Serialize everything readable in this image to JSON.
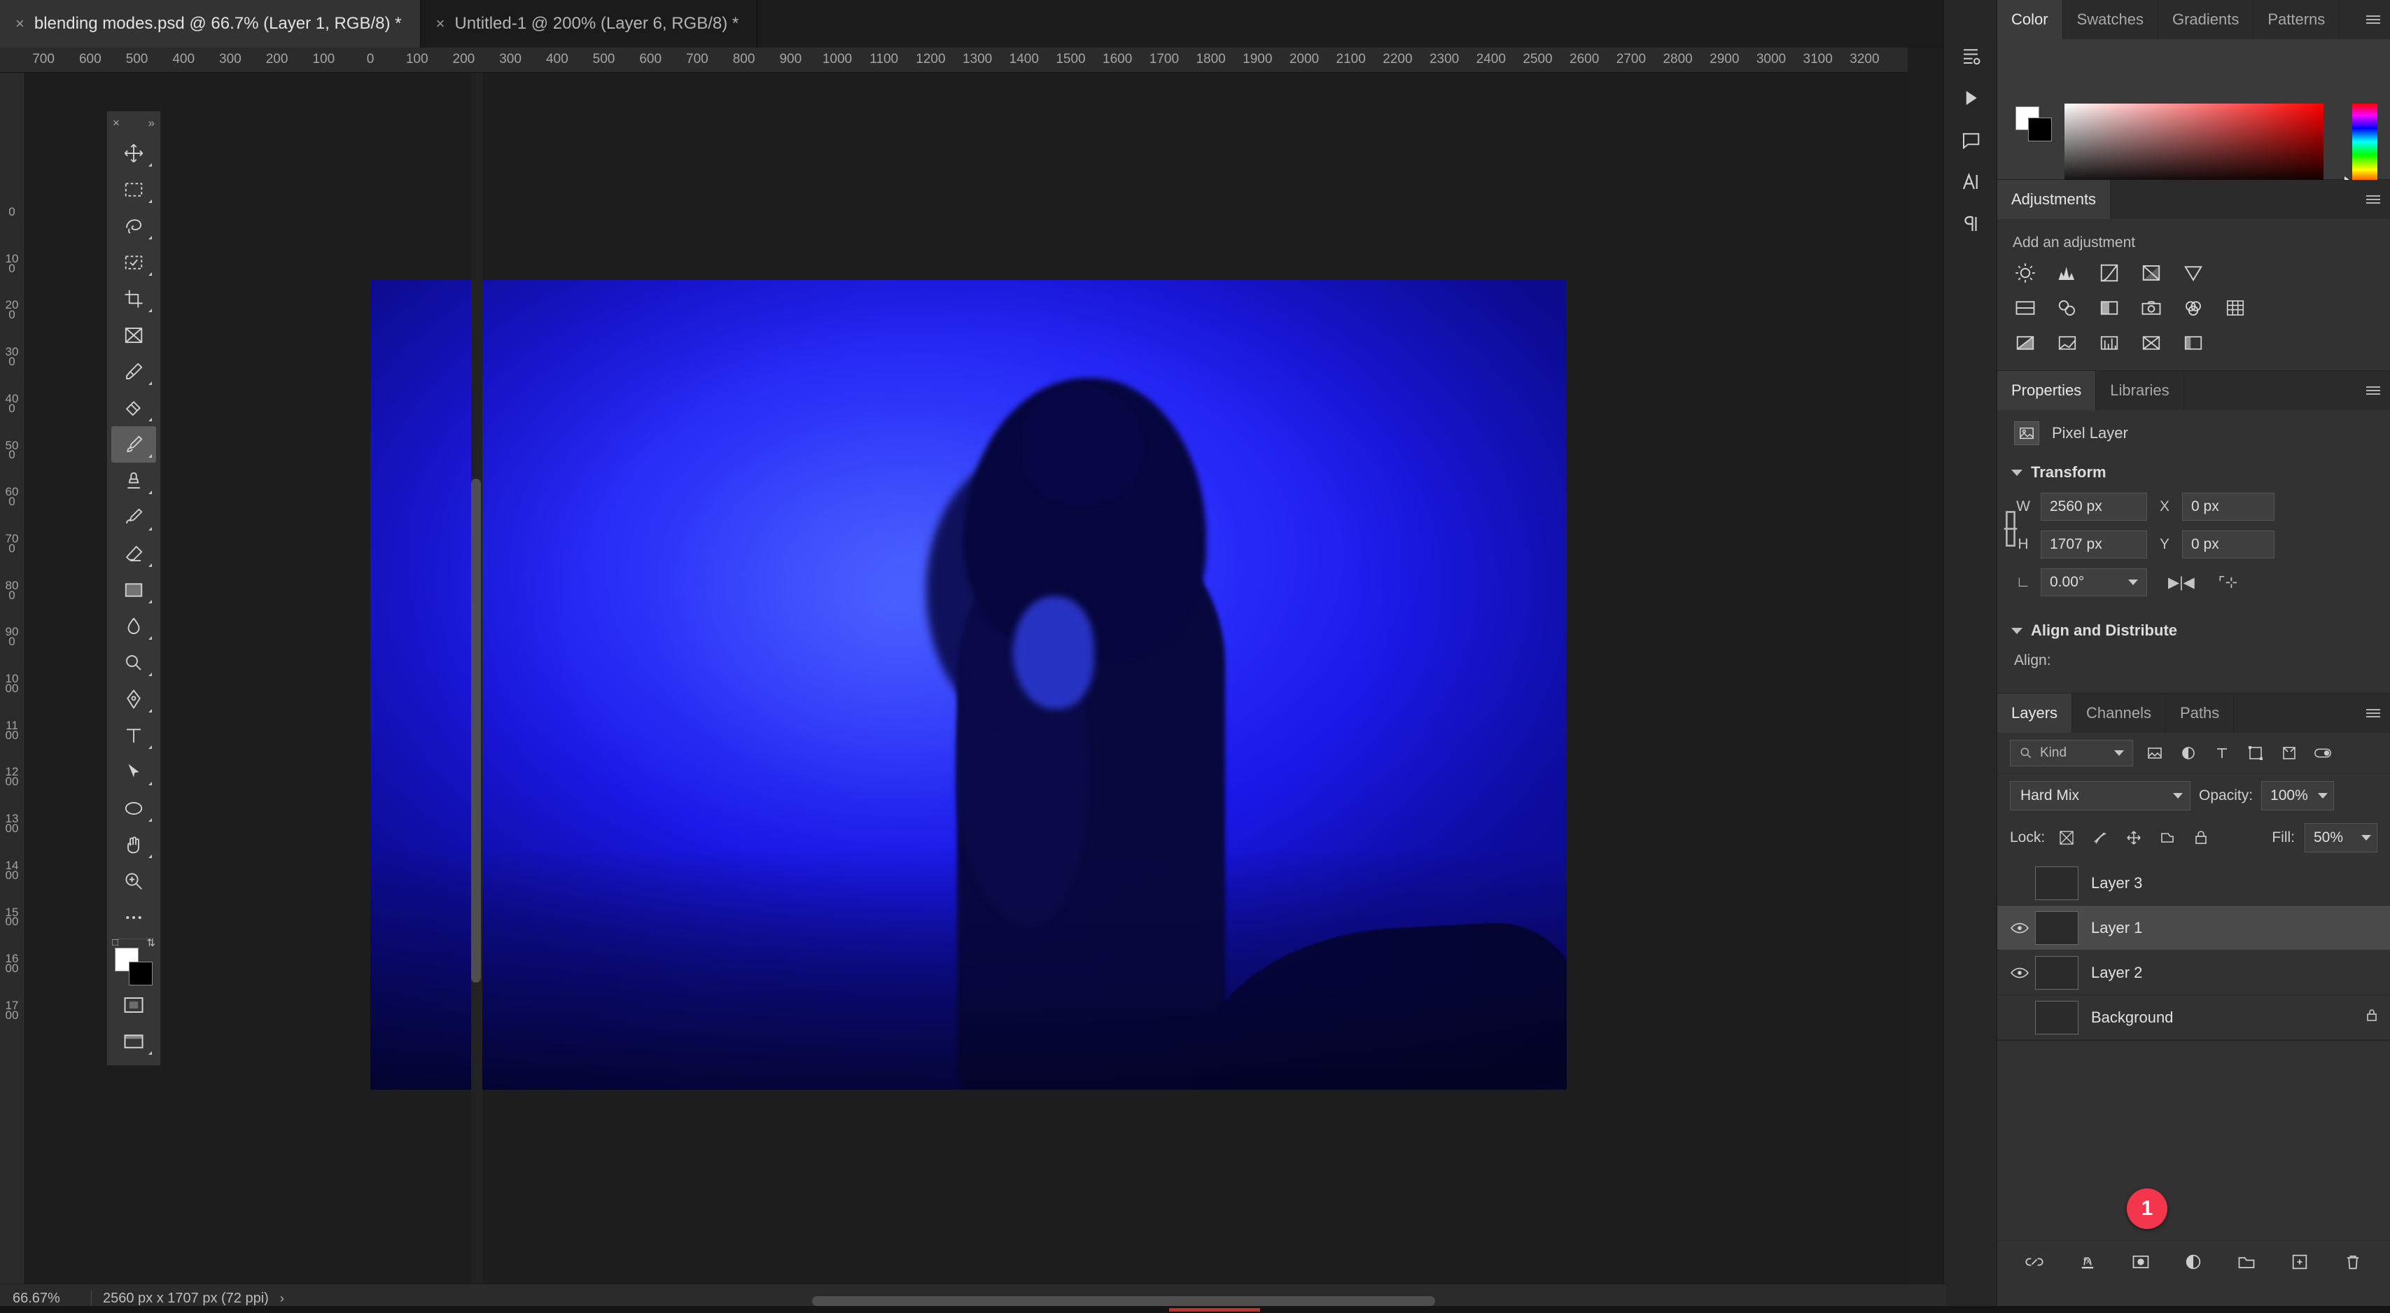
{
  "app": "Adobe Photoshop",
  "tabs": [
    {
      "title": "blending modes.psd @ 66.7% (Layer 1, RGB/8) *",
      "close": "×",
      "active": true
    },
    {
      "title": "Untitled-1 @ 200% (Layer 6, RGB/8) *",
      "close": "×",
      "active": false
    }
  ],
  "tabbar": {
    "collapse": "«"
  },
  "rulers": {
    "horizontal": [
      "700",
      "600",
      "500",
      "400",
      "300",
      "200",
      "100",
      "0",
      "100",
      "200",
      "300",
      "400",
      "500",
      "600",
      "700",
      "800",
      "900",
      "1000",
      "1100",
      "1200",
      "1300",
      "1400",
      "1500",
      "1600",
      "1700",
      "1800",
      "1900",
      "2000",
      "2100",
      "2200",
      "2300",
      "2400",
      "2500",
      "2600",
      "2700",
      "2800",
      "2900",
      "3000",
      "3100",
      "3200"
    ],
    "vertical": [
      "0",
      "100",
      "200",
      "300",
      "400",
      "500",
      "600",
      "700",
      "800",
      "900",
      "1000",
      "1100",
      "1200",
      "1300",
      "1400",
      "1500",
      "1600",
      "1700"
    ]
  },
  "toolbar": {
    "close": "×",
    "expand": "»",
    "tools": [
      {
        "name": "move-tool",
        "label": "Move Tool",
        "active": false,
        "corner": true
      },
      {
        "name": "rectangular-marquee-tool",
        "label": "Rectangular Marquee Tool",
        "active": false,
        "corner": true
      },
      {
        "name": "lasso-tool",
        "label": "Lasso Tool",
        "active": false,
        "corner": true
      },
      {
        "name": "object-selection-tool",
        "label": "Object Selection Tool",
        "active": false,
        "corner": true
      },
      {
        "name": "crop-tool",
        "label": "Crop Tool",
        "active": false,
        "corner": true
      },
      {
        "name": "frame-tool",
        "label": "Frame Tool",
        "active": false,
        "corner": false
      },
      {
        "name": "eyedropper-tool",
        "label": "Eyedropper Tool",
        "active": false,
        "corner": true
      },
      {
        "name": "spot-healing-brush-tool",
        "label": "Spot Healing Brush Tool",
        "active": false,
        "corner": true
      },
      {
        "name": "brush-tool",
        "label": "Brush Tool",
        "active": true,
        "corner": true
      },
      {
        "name": "clone-stamp-tool",
        "label": "Clone Stamp Tool",
        "active": false,
        "corner": true
      },
      {
        "name": "history-brush-tool",
        "label": "History Brush Tool",
        "active": false,
        "corner": true
      },
      {
        "name": "eraser-tool",
        "label": "Eraser Tool",
        "active": false,
        "corner": true
      },
      {
        "name": "gradient-tool",
        "label": "Gradient Tool",
        "active": false,
        "corner": true
      },
      {
        "name": "blur-tool",
        "label": "Blur Tool",
        "active": false,
        "corner": true
      },
      {
        "name": "dodge-tool",
        "label": "Dodge Tool",
        "active": false,
        "corner": true
      },
      {
        "name": "pen-tool",
        "label": "Pen Tool",
        "active": false,
        "corner": true
      },
      {
        "name": "type-tool",
        "label": "Horizontal Type Tool",
        "active": false,
        "corner": true
      },
      {
        "name": "path-selection-tool",
        "label": "Path Selection Tool",
        "active": false,
        "corner": true
      },
      {
        "name": "ellipse-tool",
        "label": "Ellipse Tool",
        "active": false,
        "corner": true
      },
      {
        "name": "hand-tool",
        "label": "Hand Tool",
        "active": false,
        "corner": true
      },
      {
        "name": "zoom-tool",
        "label": "Zoom Tool",
        "active": false,
        "corner": false
      },
      {
        "name": "edit-toolbar",
        "label": "Edit Toolbar",
        "active": false,
        "corner": false
      }
    ],
    "foreground_color": "#ffffff",
    "background_color": "#000000",
    "default_colors_label": "Default Foreground and Background Colors",
    "swap_colors_label": "Switch Foreground and Background Colors",
    "quick_mask_label": "Edit in Quick Mask Mode",
    "screen_mode_label": "Change Screen Mode"
  },
  "rail": {
    "items": [
      {
        "name": "history-icon",
        "label": "History"
      },
      {
        "name": "actions-icon",
        "label": "Actions"
      },
      {
        "name": "comments-icon",
        "label": "Comments"
      },
      {
        "name": "character-icon",
        "label": "Character"
      },
      {
        "name": "paragraph-icon",
        "label": "Paragraph"
      }
    ]
  },
  "color_panel": {
    "tabs": [
      {
        "label": "Color",
        "active": true
      },
      {
        "label": "Swatches",
        "active": false
      },
      {
        "label": "Gradients",
        "active": false
      },
      {
        "label": "Patterns",
        "active": false
      }
    ],
    "foreground": "#ffffff",
    "background": "#000000",
    "spectrum_base": "#ff0000"
  },
  "adjustments_panel": {
    "title": "Adjustments",
    "subtitle": "Add an adjustment",
    "rows": [
      [
        {
          "name": "brightness-contrast-icon",
          "label": "Brightness/Contrast"
        },
        {
          "name": "levels-icon",
          "label": "Levels"
        },
        {
          "name": "curves-icon",
          "label": "Curves"
        },
        {
          "name": "exposure-icon",
          "label": "Exposure"
        },
        {
          "name": "vibrance-icon",
          "label": "Vibrance"
        }
      ],
      [
        {
          "name": "hue-saturation-icon",
          "label": "Hue/Saturation"
        },
        {
          "name": "color-balance-icon",
          "label": "Color Balance"
        },
        {
          "name": "black-white-icon",
          "label": "Black & White"
        },
        {
          "name": "photo-filter-icon",
          "label": "Photo Filter"
        },
        {
          "name": "channel-mixer-icon",
          "label": "Channel Mixer"
        },
        {
          "name": "color-lookup-icon",
          "label": "Color Lookup"
        }
      ],
      [
        {
          "name": "invert-icon",
          "label": "Invert"
        },
        {
          "name": "posterize-icon",
          "label": "Posterize"
        },
        {
          "name": "threshold-icon",
          "label": "Threshold"
        },
        {
          "name": "gradient-map-icon",
          "label": "Gradient Map"
        },
        {
          "name": "selective-color-icon",
          "label": "Selective Color"
        }
      ]
    ]
  },
  "properties_panel": {
    "tabs": [
      {
        "label": "Properties",
        "active": true
      },
      {
        "label": "Libraries",
        "active": false
      }
    ],
    "layer_type": "Pixel Layer",
    "transform": {
      "title": "Transform",
      "w_label": "W",
      "w_value": "2560 px",
      "h_label": "H",
      "h_value": "1707 px",
      "x_label": "X",
      "x_value": "0 px",
      "y_label": "Y",
      "y_value": "0 px",
      "angle_value": "0.00°",
      "flip_h_label": "Flip Horizontal",
      "flip_v_label": "Flip Vertical",
      "link_label": "Maintain aspect ratio"
    },
    "align": {
      "title": "Align and Distribute",
      "label": "Align:"
    }
  },
  "layers_panel": {
    "tabs": [
      {
        "label": "Layers",
        "active": true
      },
      {
        "label": "Channels",
        "active": false
      },
      {
        "label": "Paths",
        "active": false
      }
    ],
    "filter": {
      "kind_label": "Kind",
      "icons": [
        {
          "name": "filter-pixel-icon",
          "label": "Filter for pixel layers"
        },
        {
          "name": "filter-adjustment-icon",
          "label": "Filter for adjustment layers"
        },
        {
          "name": "filter-type-icon",
          "label": "Filter for type layers"
        },
        {
          "name": "filter-shape-icon",
          "label": "Filter for shape layers"
        },
        {
          "name": "filter-smart-object-icon",
          "label": "Filter for smart objects"
        },
        {
          "name": "filter-toggle-icon",
          "label": "Turn layer filtering on/off"
        }
      ]
    },
    "blend_mode": "Hard Mix",
    "opacity_label": "Opacity:",
    "opacity_value": "100%",
    "lock_label": "Lock:",
    "lock_icons": [
      {
        "name": "lock-transparent-pixels-icon",
        "label": "Lock transparent pixels"
      },
      {
        "name": "lock-image-pixels-icon",
        "label": "Lock image pixels"
      },
      {
        "name": "lock-position-icon",
        "label": "Lock position"
      },
      {
        "name": "lock-artboard-nesting-icon",
        "label": "Prevent auto-nesting"
      },
      {
        "name": "lock-all-icon",
        "label": "Lock all"
      }
    ],
    "fill_label": "Fill:",
    "fill_value": "50%",
    "layers": [
      {
        "name": "Layer 3",
        "visible": false,
        "selected": false,
        "locked": false,
        "thumb": "th-l3"
      },
      {
        "name": "Layer 1",
        "visible": true,
        "selected": true,
        "locked": false,
        "thumb": "th-l1"
      },
      {
        "name": "Layer 2",
        "visible": true,
        "selected": false,
        "locked": false,
        "thumb": "th-l2"
      },
      {
        "name": "Background",
        "visible": false,
        "selected": false,
        "locked": true,
        "thumb": "th-bg"
      }
    ],
    "footer": [
      {
        "name": "link-layers-icon",
        "label": "Link layers"
      },
      {
        "name": "layer-style-icon",
        "label": "Add a layer style"
      },
      {
        "name": "layer-mask-icon",
        "label": "Add layer mask"
      },
      {
        "name": "adjustment-layer-icon",
        "label": "Create new fill or adjustment layer"
      },
      {
        "name": "new-group-icon",
        "label": "Create a new group"
      },
      {
        "name": "new-layer-icon",
        "label": "Create a new layer"
      },
      {
        "name": "delete-layer-icon",
        "label": "Delete layer"
      }
    ]
  },
  "statusbar": {
    "zoom": "66.67%",
    "dimensions": "2560 px x 1707 px (72 ppi)",
    "arrow": "›"
  },
  "annotation": {
    "badge": "1",
    "color": "#f4364c"
  }
}
